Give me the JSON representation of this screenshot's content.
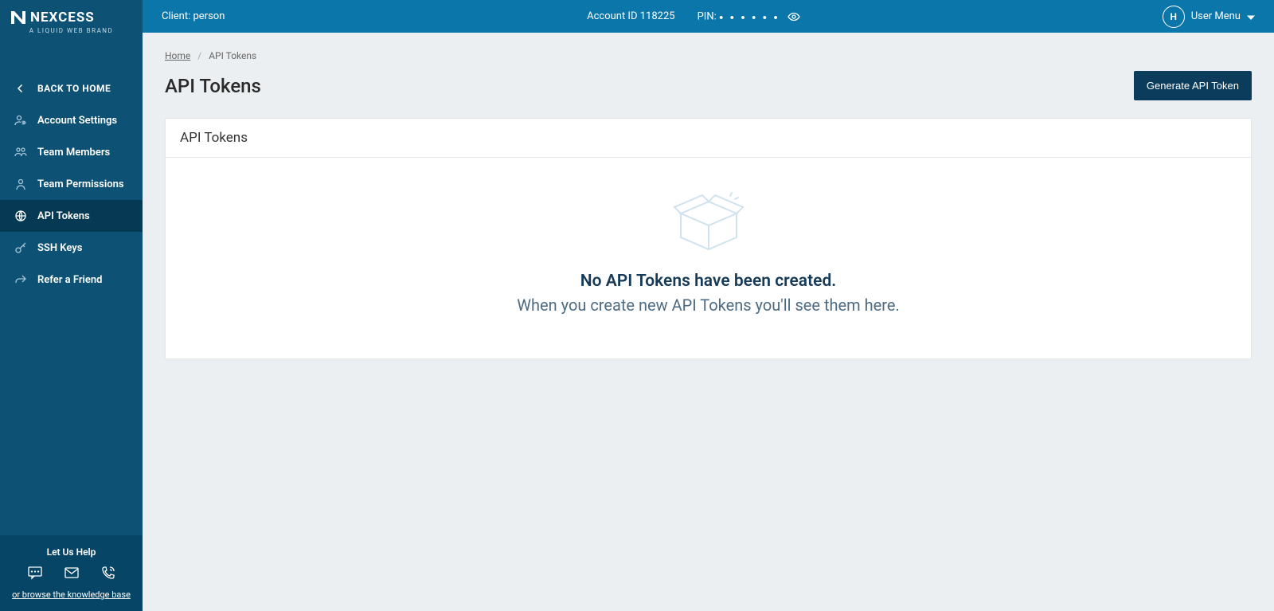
{
  "brand": {
    "name": "NEXCESS",
    "tagline": "A LIQUID WEB BRAND"
  },
  "sidebar": {
    "back_label": "BACK TO HOME",
    "items": [
      {
        "label": "Account Settings"
      },
      {
        "label": "Team Members"
      },
      {
        "label": "Team Permissions"
      },
      {
        "label": "API Tokens"
      },
      {
        "label": "SSH Keys"
      },
      {
        "label": "Refer a Friend"
      }
    ],
    "help_label": "Let Us Help",
    "kb_link": "or browse the knowledge base"
  },
  "topbar": {
    "client_label": "Client: person",
    "account_label": "Account ID 118225",
    "pin_label": "PIN:",
    "pin_dots": "● ● ● ● ● ●",
    "avatar_initial": "H",
    "user_menu_label": "User Menu"
  },
  "breadcrumb": {
    "home": "Home",
    "current": "API Tokens"
  },
  "page": {
    "title": "API Tokens",
    "generate_btn": "Generate API Token"
  },
  "card": {
    "header": "API Tokens",
    "empty_title": "No API Tokens have been created.",
    "empty_sub": "When you create new API Tokens you'll see them here."
  }
}
